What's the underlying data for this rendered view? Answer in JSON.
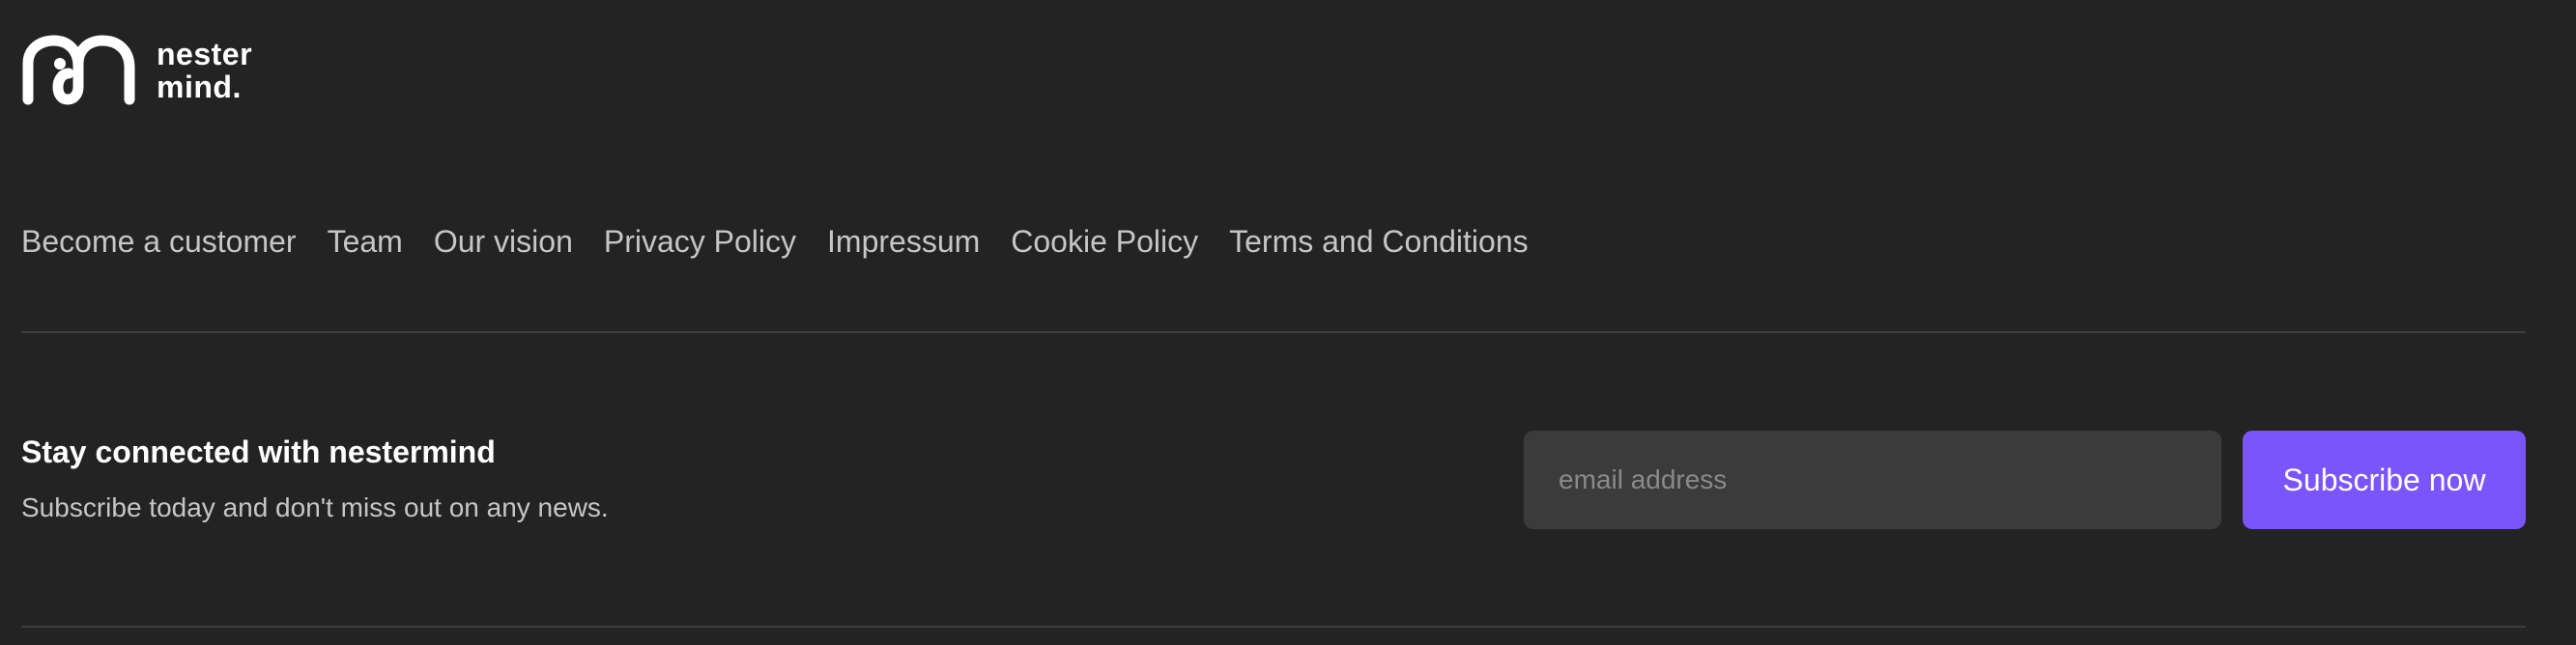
{
  "logo": {
    "icon": "nestermind-logo-icon",
    "line1": "nester",
    "line2": "mind."
  },
  "nav": {
    "items": [
      {
        "label": "Become a customer"
      },
      {
        "label": "Team"
      },
      {
        "label": "Our vision"
      },
      {
        "label": "Privacy Policy"
      },
      {
        "label": "Impressum"
      },
      {
        "label": "Cookie Policy"
      },
      {
        "label": "Terms and Conditions"
      }
    ]
  },
  "newsletter": {
    "title": "Stay connected with nestermind",
    "subtitle": "Subscribe today and don't miss out on any news.",
    "email_value": "",
    "email_placeholder": "email address",
    "button_label": "Subscribe now"
  },
  "colors": {
    "background": "#232323",
    "accent": "#7b55fb",
    "input_background": "#3b3b3b",
    "divider": "#3d3d3d"
  }
}
